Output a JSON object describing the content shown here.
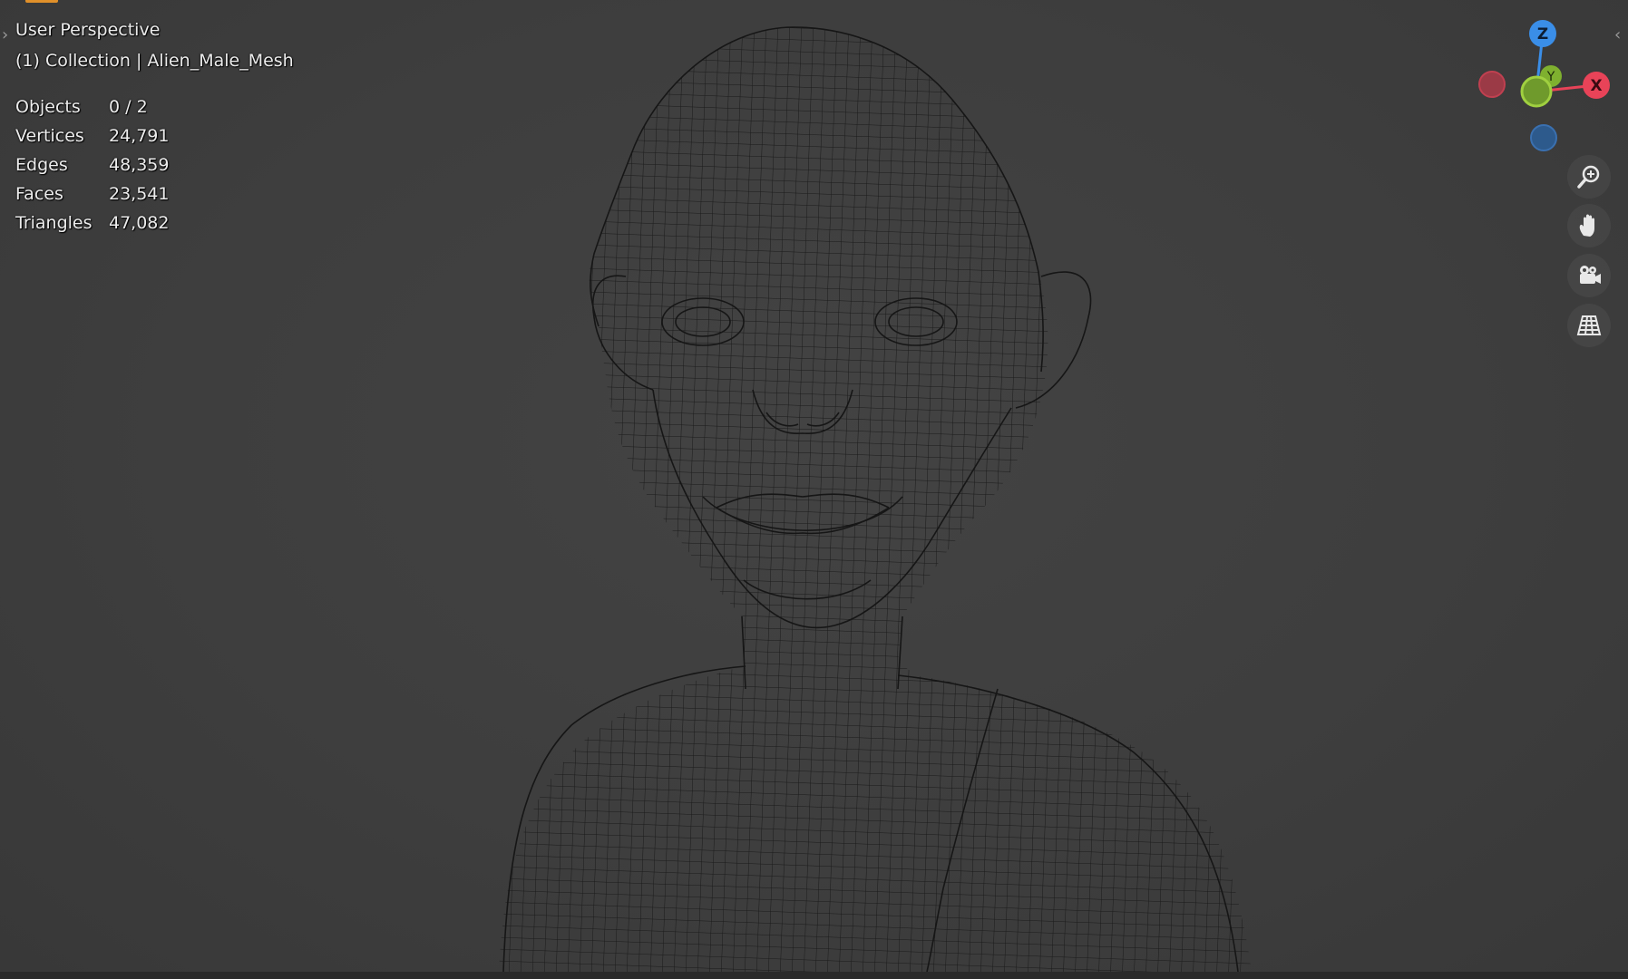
{
  "viewport": {
    "view_name": "User Perspective",
    "collection_label": "(1) Collection | Alien_Male_Mesh"
  },
  "stats": [
    {
      "label": "Objects",
      "value": "0 / 2"
    },
    {
      "label": "Vertices",
      "value": "24,791"
    },
    {
      "label": "Edges",
      "value": "48,359"
    },
    {
      "label": "Faces",
      "value": "23,541"
    },
    {
      "label": "Triangles",
      "value": "47,082"
    }
  ],
  "gizmo": {
    "z_label": "Z",
    "y_label": "Y",
    "x_label": "X",
    "colors": {
      "x": "#e84358",
      "y": "#7fb02f",
      "z": "#3a8ee8"
    }
  },
  "nav_buttons": [
    {
      "name": "zoom-icon"
    },
    {
      "name": "pan-hand-icon"
    },
    {
      "name": "camera-icon"
    },
    {
      "name": "ortho-grid-icon"
    }
  ]
}
